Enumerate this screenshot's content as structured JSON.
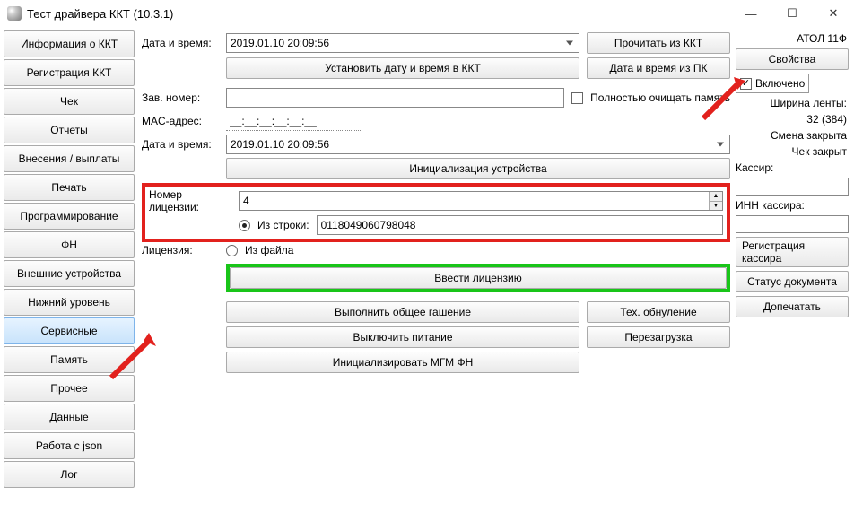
{
  "window": {
    "title": "Тест драйвера ККТ (10.3.1)"
  },
  "sidebar": {
    "items": [
      "Информация о ККТ",
      "Регистрация ККТ",
      "Чек",
      "Отчеты",
      "Внесения / выплаты",
      "Печать",
      "Программирование",
      "ФН",
      "Внешние устройства",
      "Нижний уровень",
      "Сервисные",
      "Память",
      "Прочее",
      "Данные",
      "Работа с json",
      "Лог"
    ],
    "active_index": 10
  },
  "main": {
    "date_time_label": "Дата и время:",
    "date_time_value": "2019.01.10 20:09:56",
    "read_from_kkt": "Прочитать из ККТ",
    "set_datetime_kkt": "Установить дату и время в ККТ",
    "datetime_from_pc": "Дата и время из ПК",
    "serial_label": "Зав. номер:",
    "serial_value": "",
    "full_clear_label": "Полностью очищать память",
    "mac_label": "MAC-адрес:",
    "mac_value": "__:__:__:__:__:__",
    "date_time_label2": "Дата и время:",
    "date_time_value2": "2019.01.10 20:09:56",
    "init_device": "Инициализация устройства",
    "lic_number_label": "Номер лицензии:",
    "lic_number_value": "4",
    "license_label": "Лицензия:",
    "from_string_label": "Из строки:",
    "from_string_value": "0118049060798048",
    "from_file_label": "Из файла",
    "enter_license": "Ввести лицензию",
    "run_total_reset": "Выполнить общее гашение",
    "tech_reset": "Тех. обнуление",
    "power_off": "Выключить питание",
    "reboot": "Перезагрузка",
    "init_mgm_fn": "Инициализировать МГМ ФН"
  },
  "right": {
    "device_name": "АТОЛ 11Ф",
    "properties": "Свойства",
    "enabled_label": "Включено",
    "enabled_checked": true,
    "ribbon_width_label": "Ширина ленты:",
    "ribbon_width_value": "32 (384)",
    "shift_status": "Смена закрыта",
    "check_status": "Чек закрыт",
    "cashier_label": "Кассир:",
    "cashier_value": "",
    "cashier_inn_label": "ИНН кассира:",
    "cashier_inn_value": "",
    "register_cashier": "Регистрация кассира",
    "doc_status": "Статус документа",
    "finish_print": "Допечатать"
  }
}
